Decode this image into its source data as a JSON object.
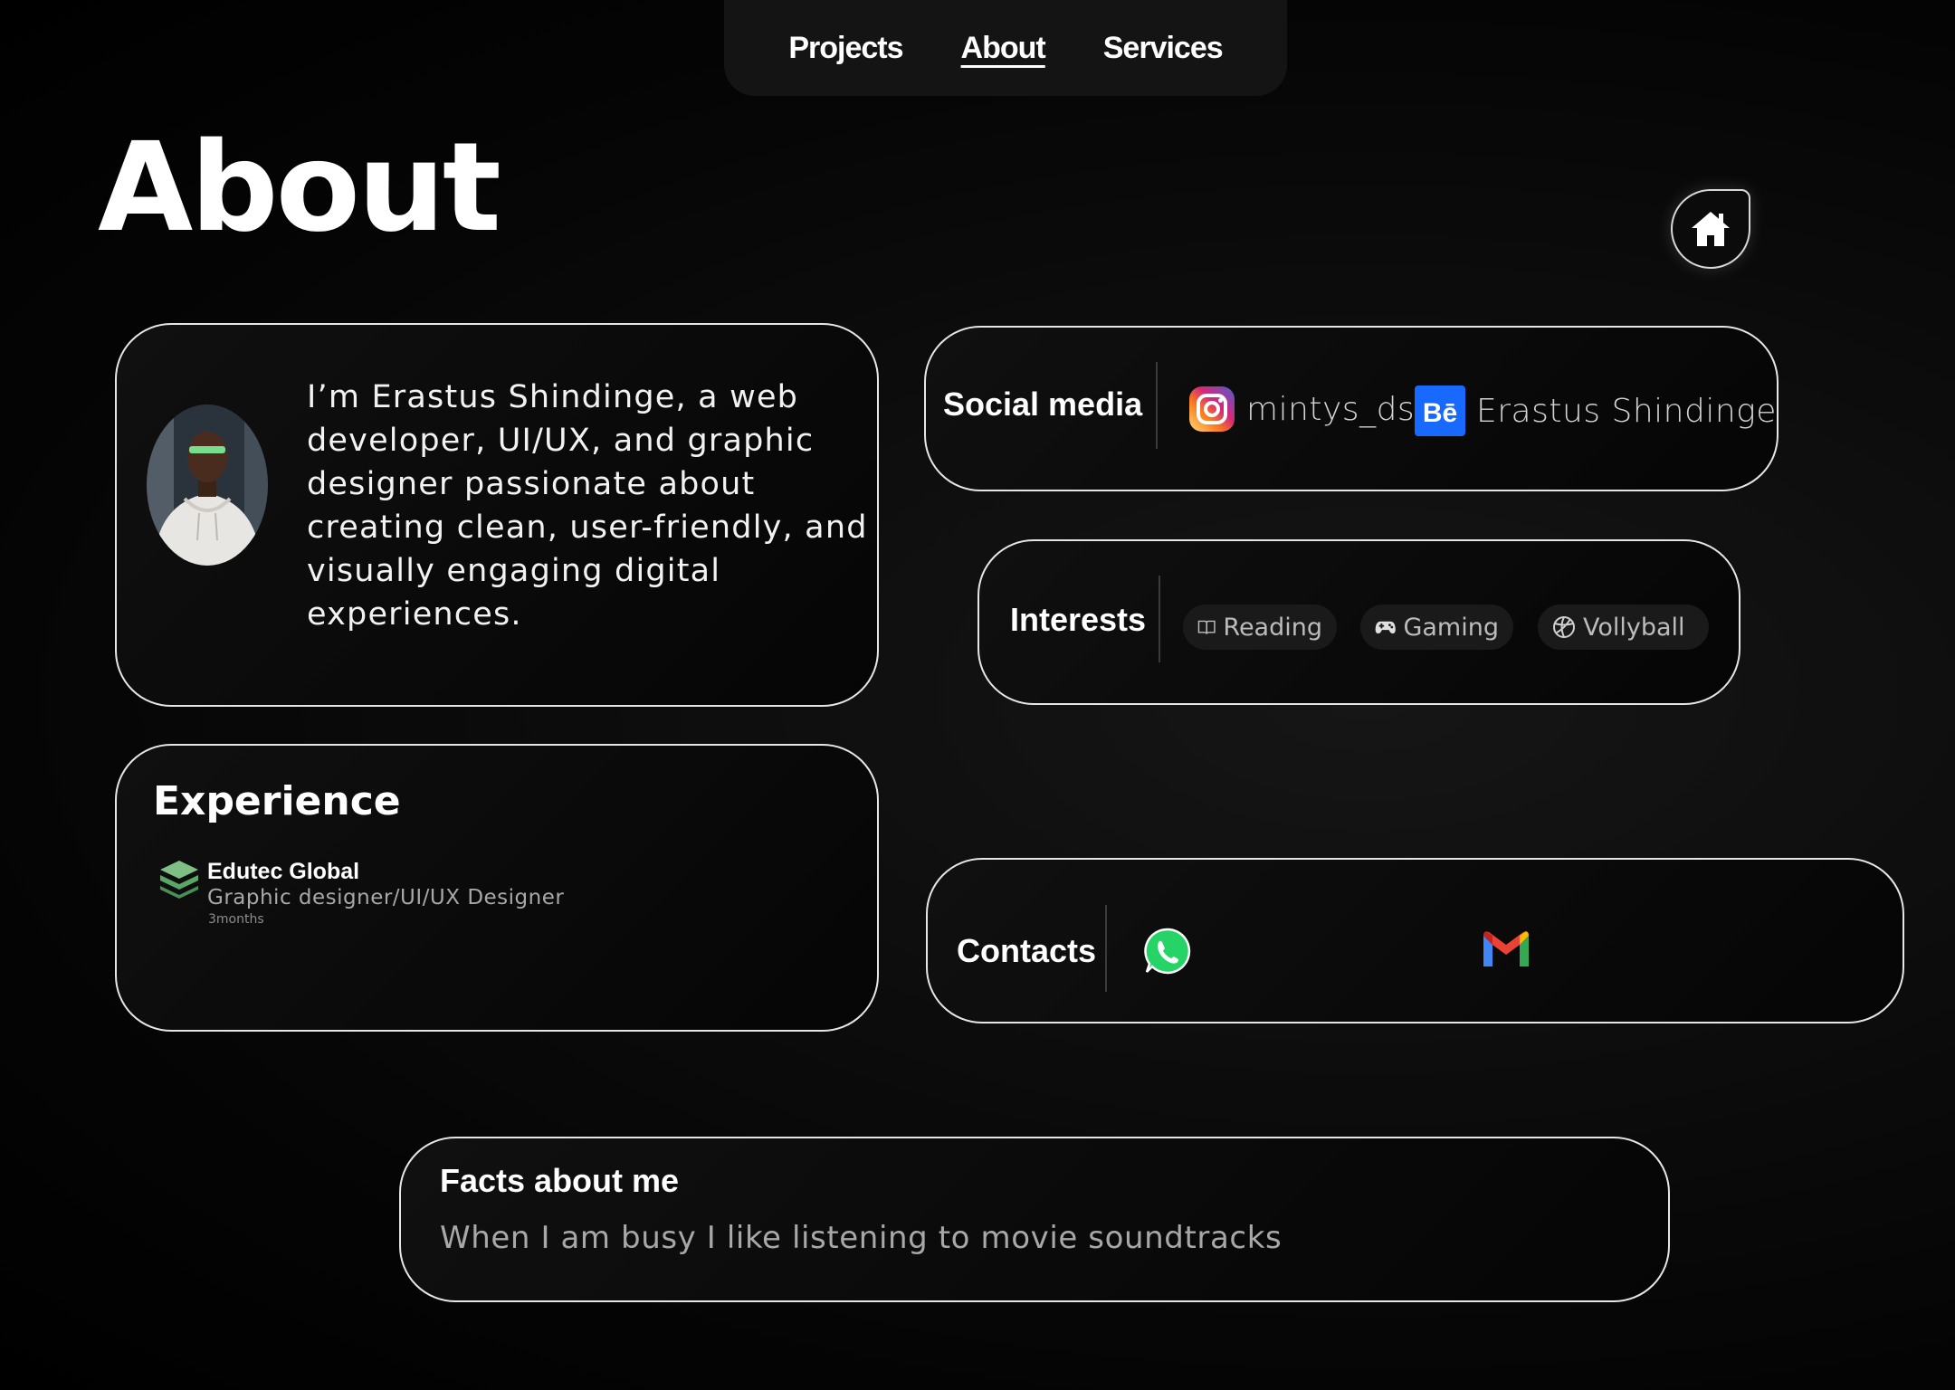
{
  "nav": {
    "items": [
      {
        "label": "Projects",
        "active": false
      },
      {
        "label": "About",
        "active": true
      },
      {
        "label": "Services",
        "active": false
      }
    ]
  },
  "page": {
    "title": "About"
  },
  "home_button": {
    "icon": "home-icon"
  },
  "intro": {
    "text": "I’m Erastus Shindinge, a web developer, UI/UX, and graphic designer passionate about creating clean, user-friendly, and visually engaging digital experiences."
  },
  "social": {
    "label": "Social media",
    "items": [
      {
        "icon": "instagram-icon",
        "label": "mintys_ds"
      },
      {
        "icon": "behance-icon",
        "label": "Erastus Shindinge"
      }
    ]
  },
  "interests": {
    "label": "Interests",
    "items": [
      {
        "icon": "book-icon",
        "label": "Reading"
      },
      {
        "icon": "gamepad-icon",
        "label": "Gaming"
      },
      {
        "icon": "volleyball-icon",
        "label": "Vollyball"
      }
    ]
  },
  "experience": {
    "title": "Experience",
    "company": "Edutec Global",
    "role": "Graphic designer/UI/UX Designer",
    "duration": "3months"
  },
  "contacts": {
    "label": "Contacts",
    "items": [
      {
        "icon": "whatsapp-icon"
      },
      {
        "icon": "gmail-icon"
      }
    ]
  },
  "facts": {
    "title": "Facts about me",
    "text": "When I am busy I like listening to movie soundtracks"
  },
  "colors": {
    "background": "#000000",
    "card_border": "#e6e6e6",
    "whatsapp": "#25d366",
    "behance": "#1769ff"
  }
}
